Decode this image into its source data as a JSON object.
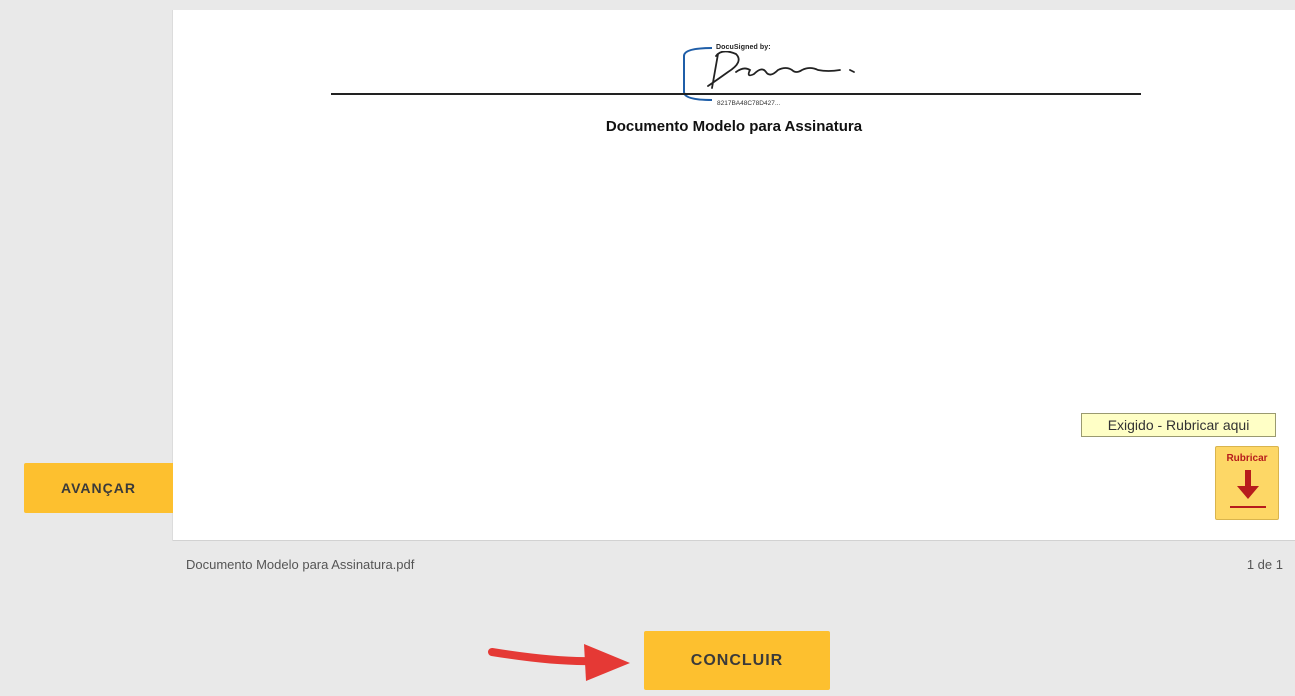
{
  "document": {
    "title": "Documento Modelo para Assinatura",
    "signature": {
      "header": "DocuSigned by:",
      "envelope_id": "8217BA48C78D427..."
    },
    "tooltip": "Exigido - Rubricar aqui",
    "initial_tag_label": "Rubricar"
  },
  "buttons": {
    "next": "AVANÇAR",
    "finish": "CONCLUIR"
  },
  "footer": {
    "filename": "Documento Modelo para Assinatura.pdf",
    "page_indicator": "1 de 1"
  },
  "colors": {
    "accent": "#fdc02f",
    "tooltip_bg": "#ffffc6",
    "arrow": "#e53935",
    "initial_icon": "#b71c1c"
  }
}
